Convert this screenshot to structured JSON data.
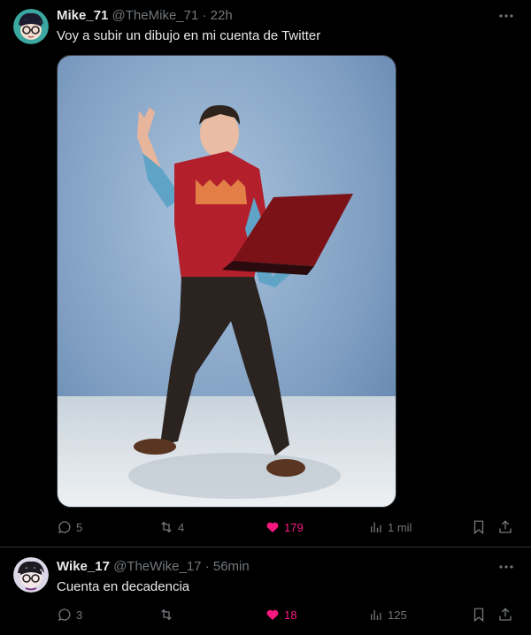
{
  "tweets": [
    {
      "name": "Mike_71",
      "handle": "@TheMike_71",
      "time": "· 22h",
      "text": "Voy a subir un dibujo en mi cuenta de Twitter",
      "replies": "5",
      "retweets": "4",
      "likes": "179",
      "views": "1 mil",
      "liked": true
    },
    {
      "name": "Wike_17",
      "handle": "@TheWike_17",
      "time": "· 56min",
      "text": "Cuenta en decadencia",
      "replies": "3",
      "retweets": "",
      "likes": "18",
      "views": "125",
      "liked": true
    }
  ],
  "colors": {
    "background": "#000000",
    "text": "#e7e9ea",
    "muted": "#71767b",
    "like": "#f91880",
    "divider": "#2f3336"
  },
  "icons": [
    "reply-icon",
    "retweet-icon",
    "heart-icon",
    "views-icon",
    "bookmark-icon",
    "share-icon",
    "more-icon"
  ]
}
